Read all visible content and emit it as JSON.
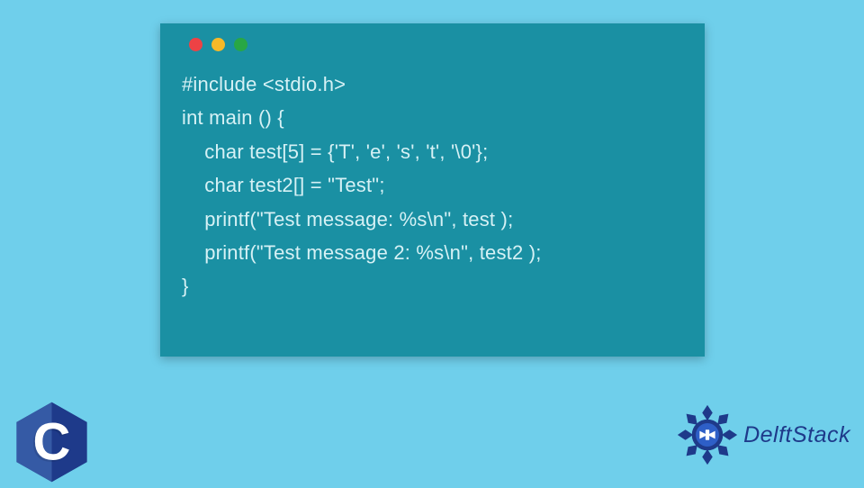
{
  "code": {
    "line1": "#include <stdio.h>",
    "line2": "int main () {",
    "line3": "    char test[5] = {'T', 'e', 's', 't', '\\0'};",
    "line4": "    char test2[] = \"Test\";",
    "line5": "    printf(\"Test message: %s\\n\", test );",
    "line6": "    printf(\"Test message 2: %s\\n\", test2 );",
    "line7": "}"
  },
  "logos": {
    "c_letter": "C",
    "brand_name": "DelftStack"
  },
  "colors": {
    "background": "#6fcfeb",
    "code_window": "#1a90a3",
    "code_text": "#d6f1f5",
    "brand_blue": "#1e3a8a",
    "c_logo_hex": "#2a4b8d"
  }
}
